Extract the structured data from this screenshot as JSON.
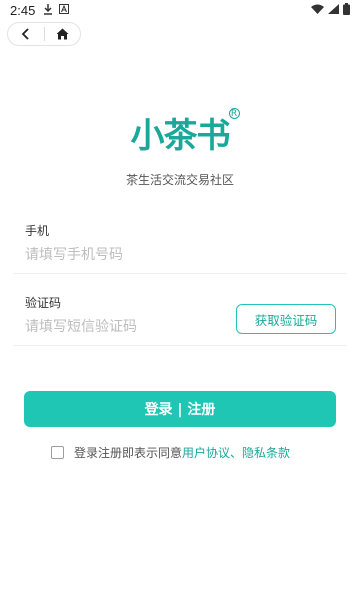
{
  "status_bar": {
    "time": "2:45",
    "icons": [
      "download-icon",
      "a-icon",
      "wifi-icon",
      "signal-icon",
      "battery-icon"
    ]
  },
  "nav": {
    "icons": [
      "back-arrow-icon",
      "home-icon"
    ]
  },
  "logo": {
    "text": "小茶书",
    "registered": "R",
    "slogan": "茶生活交流交易社区"
  },
  "form": {
    "phone_label": "手机",
    "phone_placeholder": "请填写手机号码",
    "phone_value": "",
    "code_label": "验证码",
    "code_placeholder": "请填写短信验证码",
    "code_value": "",
    "get_code_button": "获取验证码"
  },
  "login_button": "登录 | 注册",
  "agreement": {
    "checked": false,
    "prefix": "登录注册即表示同意",
    "user_agreement": "用户协议",
    "separator": "、",
    "privacy_policy": "隐私条款"
  },
  "colors": {
    "accent": "#1fc6b4",
    "accent_text": "#1aa89a",
    "placeholder": "#bdbdbd"
  }
}
